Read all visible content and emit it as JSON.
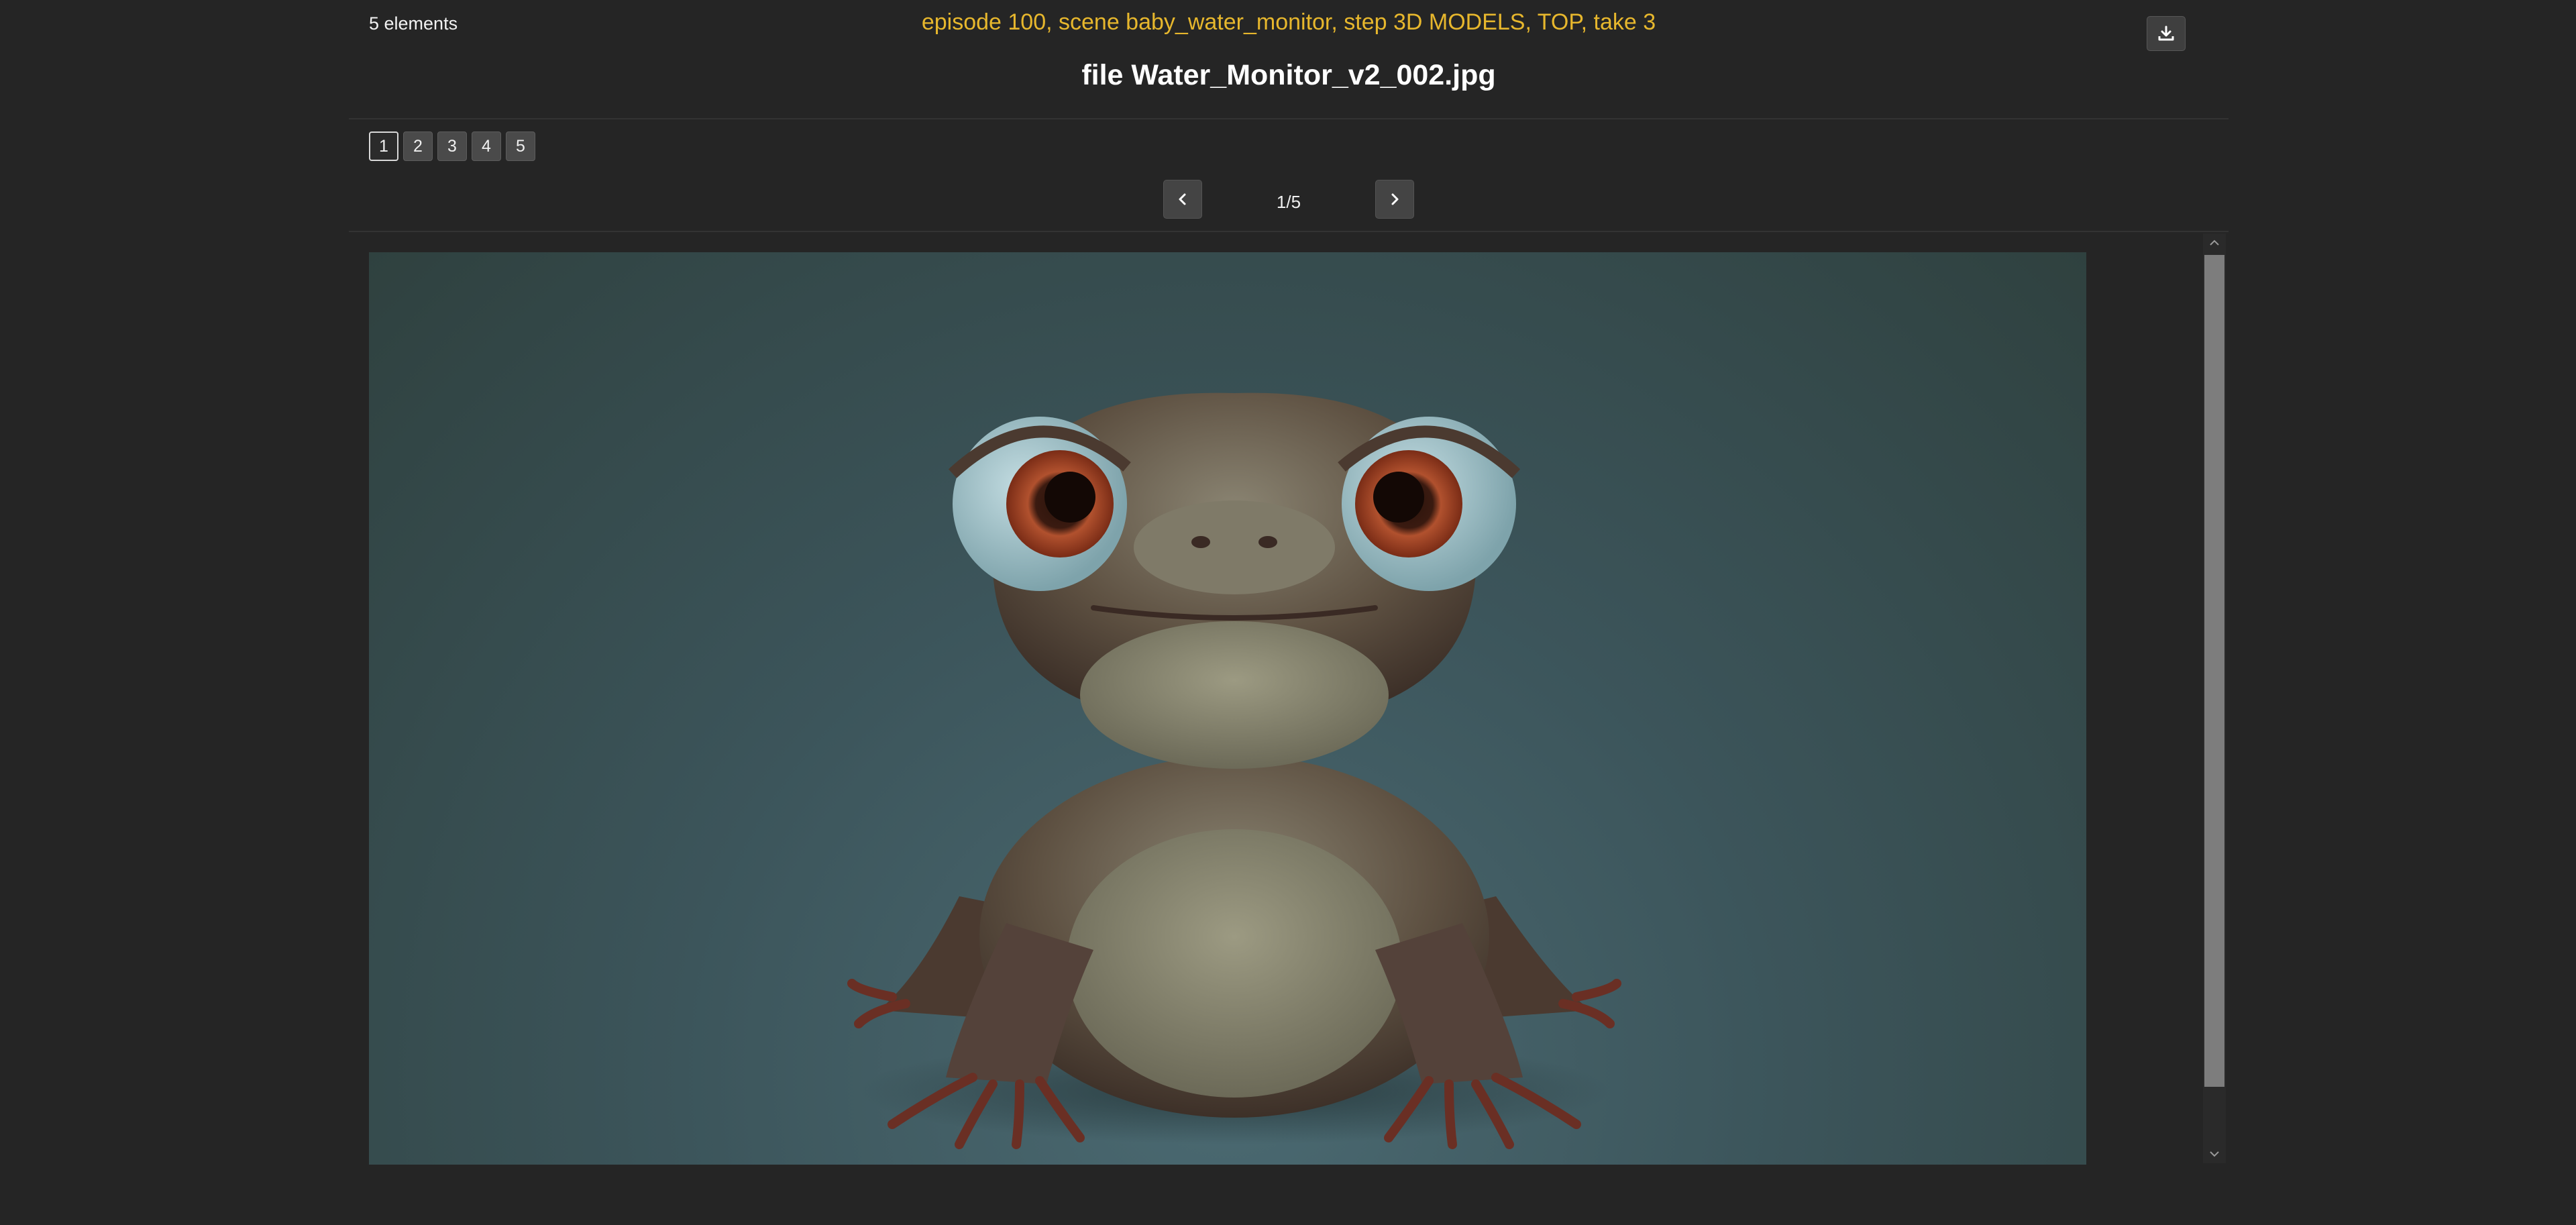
{
  "header": {
    "element_count": "5 elements",
    "context": "episode 100, scene baby_water_monitor, step 3D MODELS, TOP, take 3",
    "filename": "file Water_Monitor_v2_002.jpg",
    "download_icon": "download-icon"
  },
  "pagination": {
    "pages": [
      "1",
      "2",
      "3",
      "4",
      "5"
    ],
    "active_page": "1",
    "position": "1/5",
    "prev_icon": "chevron-left-icon",
    "next_icon": "chevron-right-icon"
  },
  "viewer": {
    "image_subject": "3D render of a baby water monitor lizard with large eyes"
  },
  "colors": {
    "background": "#252525",
    "accent": "#e7b72d",
    "button": "#4a4a4a"
  }
}
